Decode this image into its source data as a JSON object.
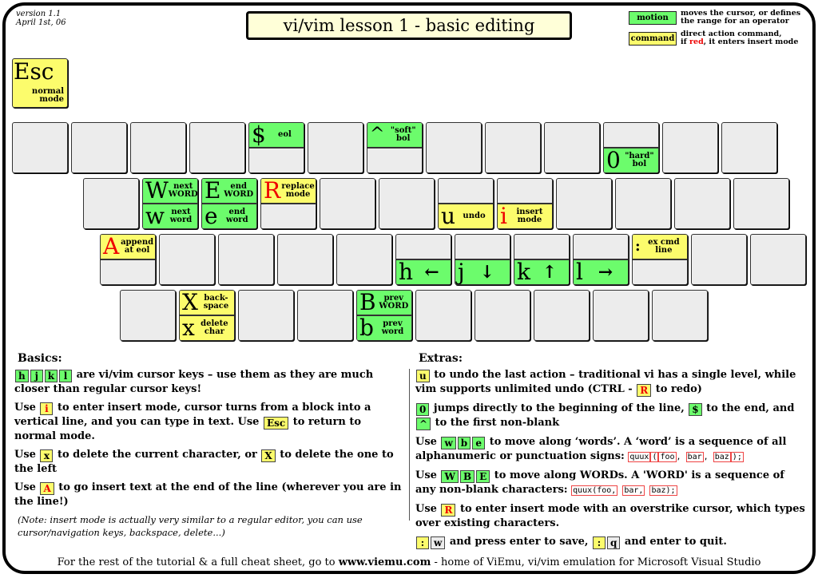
{
  "header": {
    "version": "version 1.1",
    "date": "April 1st, 06",
    "title": "vi/vim lesson 1 - basic editing"
  },
  "legend": {
    "motion_key": "motion",
    "motion_desc_1": "moves the cursor, or defines",
    "motion_desc_2": "the range for an operator",
    "command_key": "command",
    "command_desc_1": "direct action command,",
    "command_desc_2_pre": "if ",
    "command_desc_2_red": "red",
    "command_desc_2_post": ", it enters insert mode",
    "colors": {
      "motion": "#6cfc6c",
      "command": "#fcfc6c",
      "insert": "#ee0000"
    }
  },
  "esc": {
    "key": "Esc",
    "desc_1": "normal",
    "desc_2": "mode"
  },
  "keys": {
    "dollar": {
      "key": "$",
      "desc": "eol"
    },
    "caret": {
      "key": "^",
      "desc_1": "\"soft\"",
      "desc_2": "bol"
    },
    "zero": {
      "key": "0",
      "desc_1": "\"hard\"",
      "desc_2": "bol"
    },
    "W": {
      "key": "W",
      "desc_1": "next",
      "desc_2": "WORD"
    },
    "w": {
      "key": "w",
      "desc_1": "next",
      "desc_2": "word"
    },
    "E": {
      "key": "E",
      "desc_1": "end",
      "desc_2": "WORD"
    },
    "e": {
      "key": "e",
      "desc_1": "end",
      "desc_2": "word"
    },
    "R": {
      "key": "R",
      "desc_1": "replace",
      "desc_2": "mode"
    },
    "u": {
      "key": "u",
      "desc": "undo"
    },
    "i": {
      "key": "i",
      "desc_1": "insert",
      "desc_2": "mode"
    },
    "A": {
      "key": "A",
      "desc_1": "append",
      "desc_2": "at eol"
    },
    "h": {
      "key": "h",
      "arrow": "←"
    },
    "j": {
      "key": "j",
      "arrow": "↓"
    },
    "k": {
      "key": "k",
      "arrow": "↑"
    },
    "l": {
      "key": "l",
      "arrow": "→"
    },
    "colon": {
      "key": ":",
      "desc_1": "ex cmd",
      "desc_2": "line"
    },
    "X": {
      "key": "X",
      "desc_1": "back-",
      "desc_2": "space"
    },
    "x": {
      "key": "x",
      "desc_1": "delete",
      "desc_2": "char"
    },
    "B": {
      "key": "B",
      "desc_1": "prev",
      "desc_2": "WORD"
    },
    "b": {
      "key": "b",
      "desc_1": "prev",
      "desc_2": "word"
    }
  },
  "basics": {
    "heading": "Basics:",
    "p1_keys": [
      "h",
      "j",
      "k",
      "l"
    ],
    "p1_text": " are vi/vim cursor keys – use them as they are  much closer than regular cursor keys!",
    "p2_a": "Use ",
    "p2_key": "i",
    "p2_b": " to enter insert mode, cursor turns from a block into a vertical line, and you can type in text. Use ",
    "p2_key2": "Esc",
    "p2_c": "  to  return to normal mode.",
    "p3_a": "Use ",
    "p3_key": "x",
    "p3_b": " to delete the current character, or ",
    "p3_key2": "X",
    "p3_c": "  to delete the one to the left",
    "p4_a": "Use ",
    "p4_key": "A",
    "p4_b": " to go insert text at the end of the line (wherever you are in the line!)",
    "note": "(Note: insert mode is actually very similar to a regular editor, you can use cursor/navigation keys, backspace,  delete...)"
  },
  "extras": {
    "heading": "Extras:",
    "p1_key": "u",
    "p1_a": " to undo the last action – traditional vi has a single level, while vim supports unlimited undo (CTRL - ",
    "p1_key2": "R",
    "p1_b": " to redo)",
    "p2_key": "0",
    "p2_a": " jumps directly to the beginning of the line, ",
    "p2_key2": "$",
    "p2_b": " to the end, and ",
    "p2_key3": "^",
    "p2_c": " to the first non-blank",
    "p3_a": "Use ",
    "p3_keys": [
      "w",
      "b",
      "e"
    ],
    "p3_b": " to move along ‘words’. A ‘word’ is a sequence of all alphanumeric or punctuation signs:  ",
    "p3_code": [
      "quux",
      "(",
      "foo",
      ",",
      "bar",
      ",",
      "baz",
      ");"
    ],
    "p4_a": "Use ",
    "p4_keys": [
      "W",
      "B",
      "E"
    ],
    "p4_b": " to move along WORDs. A 'WORD' is a sequence of any non-blank characters:  ",
    "p4_code": [
      "quux(foo,",
      "bar,",
      "baz);"
    ],
    "p5_a": "Use ",
    "p5_key": "R",
    "p5_b": " to enter insert mode with an overstrike cursor, which types over existing characters.",
    "p6_k1": ":",
    "p6_k2": "w",
    "p6_a": " and press enter to save, ",
    "p6_k3": ":",
    "p6_k4": "q",
    "p6_b": " and enter to quit."
  },
  "footer": {
    "pre": "For the rest of the tutorial & a full cheat sheet, go to ",
    "link": "www.viemu.com",
    "post": " - home of ViEmu, vi/vim emulation for Microsoft Visual Studio"
  }
}
